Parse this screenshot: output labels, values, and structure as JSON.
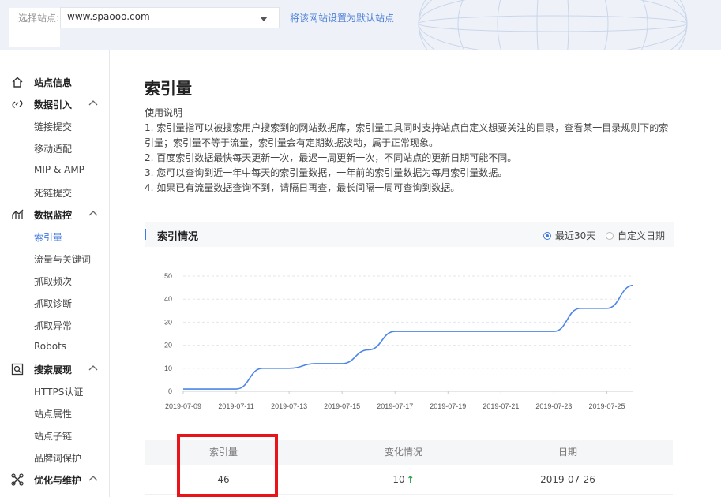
{
  "topbar": {
    "site_label": "选择站点:",
    "site_value": "www.spaooo.com",
    "default_link": "将该网站设置为默认站点"
  },
  "sidebar": {
    "groups": [
      {
        "label": "站点信息",
        "icon": "home-icon",
        "items": []
      },
      {
        "label": "数据引入",
        "icon": "data-import-icon",
        "items": [
          "链接提交",
          "移动适配",
          "MIP & AMP",
          "死链提交"
        ]
      },
      {
        "label": "数据监控",
        "icon": "monitor-icon",
        "items": [
          "索引量",
          "流量与关键词",
          "抓取频次",
          "抓取诊断",
          "抓取异常",
          "Robots"
        ]
      },
      {
        "label": "搜索展现",
        "icon": "search-display-icon",
        "items": [
          "HTTPS认证",
          "站点属性",
          "站点子链",
          "品牌词保护"
        ]
      },
      {
        "label": "优化与维护",
        "icon": "optimize-icon",
        "items": []
      }
    ],
    "active_item": "索引量"
  },
  "main": {
    "title": "索引量",
    "usage_title": "使用说明",
    "usage_lines": [
      "1. 索引量指可以被搜索用户搜索到的网站数据库，索引量工具同时支持站点自定义想要关注的目录，查看某一目录规则下的索引量；索引量不等于流量，索引量会有定期数据波动，属于正常现象。",
      "2. 百度索引数据最快每天更新一次，最迟一周更新一次，不同站点的更新日期可能不同。",
      "3. 您可以查询到近一年中每天的索引量数据，一年前的索引量数据为每月索引量数据。",
      "4. 如果已有流量数据查询不到，请隔日再查，最长间隔一周可查询到数据。"
    ],
    "panel_title": "索引情况",
    "radio_recent": "最近30天",
    "radio_custom": "自定义日期",
    "table": {
      "headers": [
        "索引量",
        "变化情况",
        "日期"
      ],
      "row": {
        "index": "46",
        "change": "10",
        "change_arrow": "↑",
        "date": "2019-07-26"
      }
    }
  },
  "chart_data": {
    "type": "line",
    "ylim": [
      0,
      50
    ],
    "yticks": [
      "0",
      "10",
      "20",
      "30",
      "40",
      "50"
    ],
    "xtick_labels": [
      "2019-07-09",
      "2019-07-11",
      "2019-07-13",
      "2019-07-15",
      "2019-07-17",
      "2019-07-19",
      "2019-07-21",
      "2019-07-23",
      "2019-07-25"
    ],
    "x": [
      "2019-07-09",
      "2019-07-10",
      "2019-07-11",
      "2019-07-12",
      "2019-07-13",
      "2019-07-14",
      "2019-07-15",
      "2019-07-16",
      "2019-07-17",
      "2019-07-18",
      "2019-07-19",
      "2019-07-20",
      "2019-07-21",
      "2019-07-22",
      "2019-07-23",
      "2019-07-24",
      "2019-07-25",
      "2019-07-26"
    ],
    "series": [
      {
        "values": [
          1,
          1,
          1,
          10,
          10,
          12,
          12,
          18,
          26,
          26,
          26,
          26,
          26,
          26,
          26,
          36,
          36,
          46
        ]
      }
    ],
    "colors": {
      "line": "#4a86e8",
      "grid": "#e3e6eb",
      "axis": "#c8ccd3"
    }
  },
  "colors": {
    "accent": "#3f78e0",
    "highlight": "#e8141a",
    "up": "#2aa34a"
  }
}
